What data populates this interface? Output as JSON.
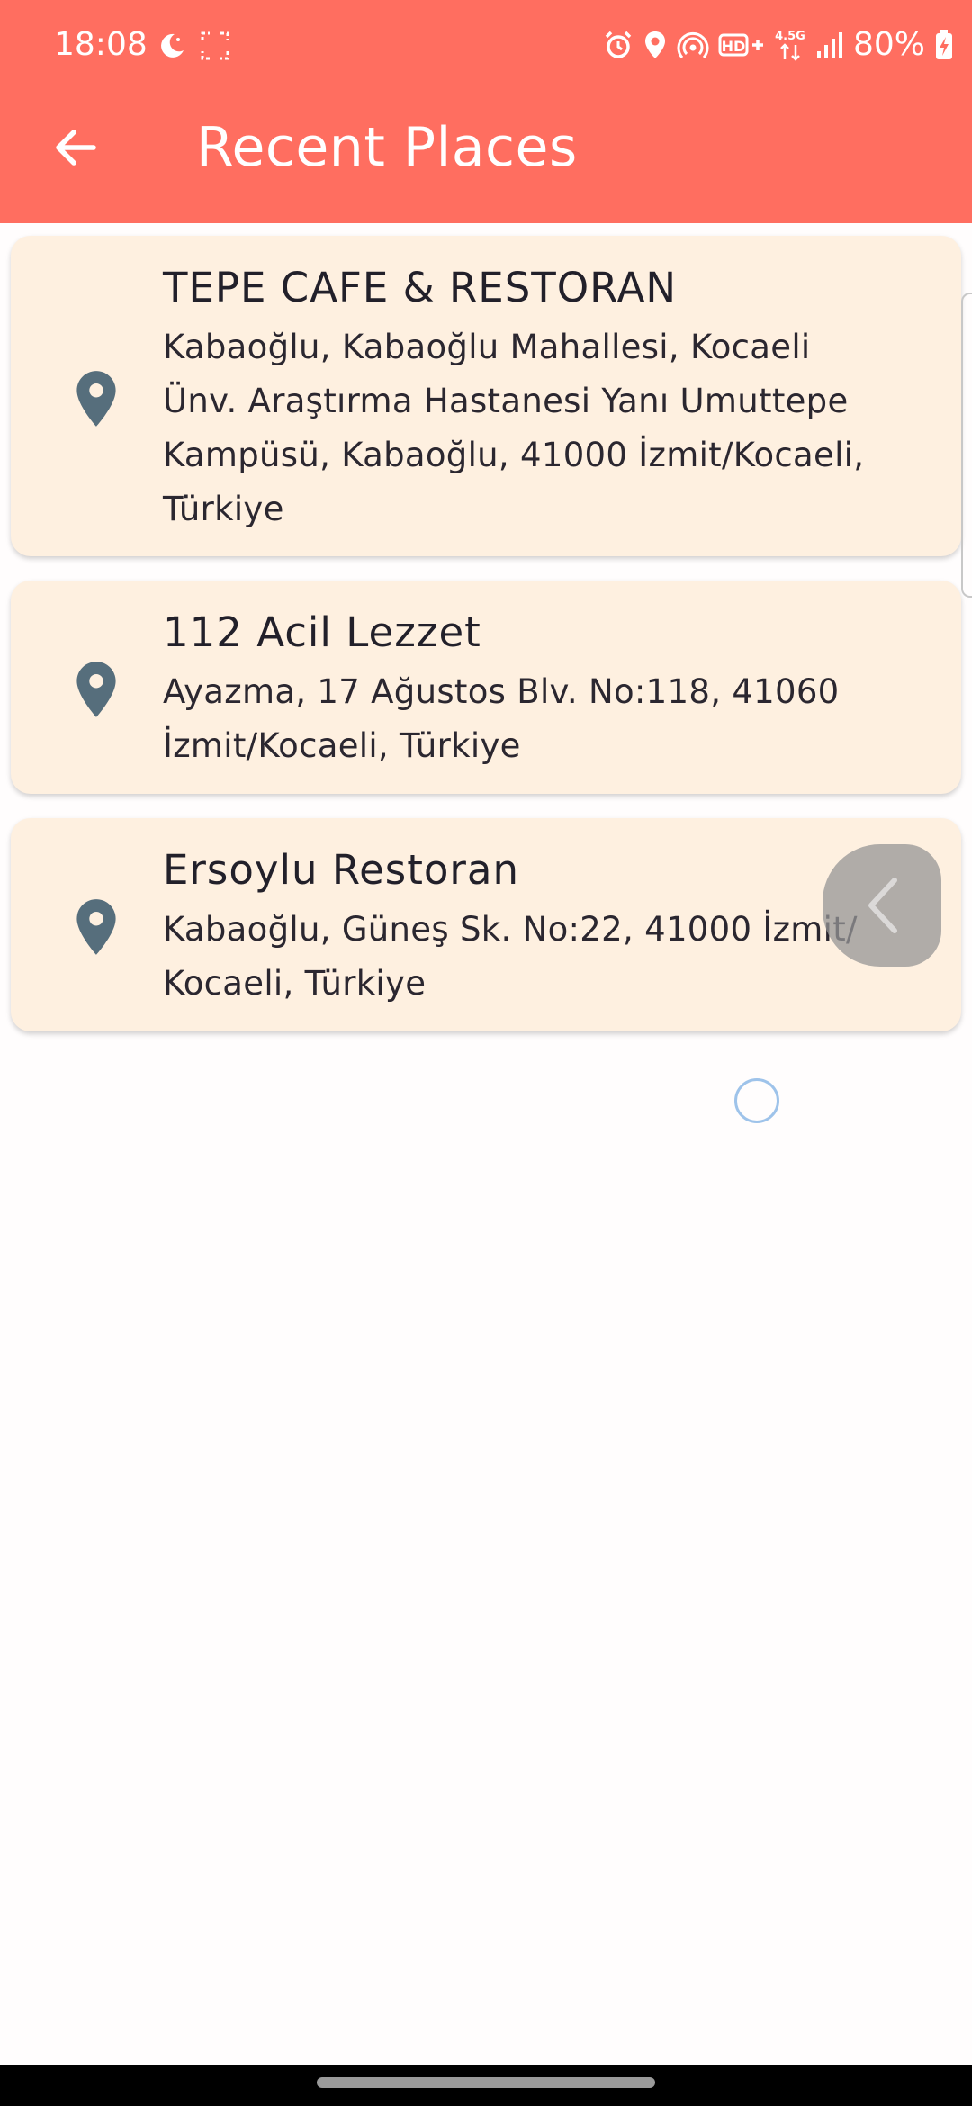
{
  "status_bar": {
    "time": "18:08",
    "battery_percent": "80%",
    "network_label": "4.5G",
    "hd_label": "HD+",
    "icons": [
      "moon-icon",
      "screen-record-icon",
      "alarm-icon",
      "location-icon",
      "hotspot-icon",
      "hd-voice-icon",
      "signal-icon",
      "battery-charging-icon"
    ]
  },
  "app_bar": {
    "title": "Recent Places",
    "back_icon": "arrow-back-icon"
  },
  "places": [
    {
      "name": "TEPE CAFE & RESTORAN",
      "address_lines": [
        "Kabaoğlu, Kabaoğlu Mahallesi, Kocaeli",
        "Ünv. Araştırma Hastanesi Yanı Umuttepe",
        "Kampüsü, Kabaoğlu, 41000 İzmit/Kocaeli,",
        "Türkiye"
      ],
      "icon": "location-pin-icon"
    },
    {
      "name": "112 Acil Lezzet",
      "address_lines": [
        "Ayazma, 17 Ağustos Blv. No:118, 41060",
        "İzmit/Kocaeli, Türkiye"
      ],
      "icon": "location-pin-icon"
    },
    {
      "name": "Ersoylu Restoran",
      "address_lines": [
        "Kabaoğlu, Güneş Sk. No:22, 41000 İzmit/",
        "Kocaeli, Türkiye"
      ],
      "icon": "location-pin-icon"
    }
  ],
  "colors": {
    "app_bar": "#ff6e60",
    "card_background": "#fef0e0",
    "pin": "#566e7c",
    "page_background": "#fffdfd"
  }
}
